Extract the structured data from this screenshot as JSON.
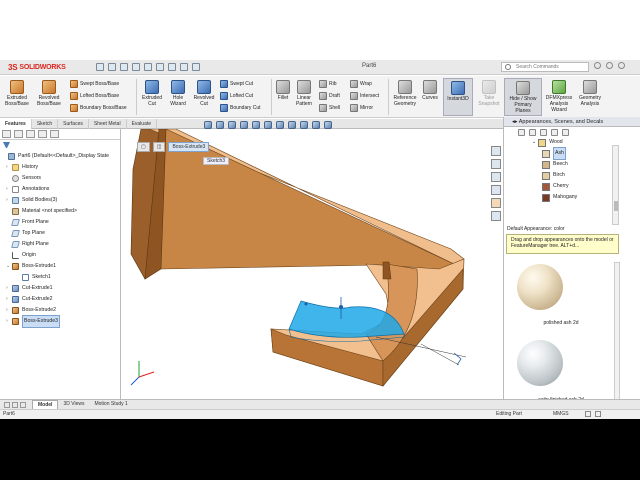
{
  "titlebar": {
    "logo_prefix": "3S",
    "logo_text": "SOLIDWORKS",
    "document_title": "Part6",
    "search_placeholder": "Search Commands"
  },
  "ribbon": {
    "extruded_boss": "Extruded\nBoss/Base",
    "revolved_boss": "Revolved\nBoss/Base",
    "swept_boss": "Swept Boss/Base",
    "lofted_boss": "Lofted Boss/Base",
    "boundary_boss": "Boundary Boss/Base",
    "extruded_cut": "Extruded\nCut",
    "hole_wizard": "Hole\nWizard",
    "revolved_cut": "Revolved\nCut",
    "swept_cut": "Swept Cut",
    "lofted_cut": "Lofted Cut",
    "boundary_cut": "Boundary Cut",
    "fillet": "Fillet",
    "linear_pattern": "Linear\nPattern",
    "rib": "Rib",
    "draft": "Draft",
    "shell": "Shell",
    "wrap": "Wrap",
    "intersect": "Intersect",
    "mirror": "Mirror",
    "reference_geometry": "Reference\nGeometry",
    "curves": "Curves",
    "instant3d": "Instant3D",
    "take_snapshot": "Take\nSnapshot",
    "hide_show_planes": "Hide / Show\nPrimary\nPlanes",
    "dfmxpress": "DFMXpress\nAnalysis\nWizard",
    "geometry_analysis": "Geometry\nAnalysis"
  },
  "command_tabs": [
    "Features",
    "Sketch",
    "Surfaces",
    "Sheet Metal",
    "Evaluate"
  ],
  "tree": {
    "root": "Part6  (Default<<Default>_Display State",
    "items": [
      {
        "label": "History",
        "icon": "folder"
      },
      {
        "label": "Sensors",
        "icon": "sensor"
      },
      {
        "label": "Annotations",
        "icon": "annotation"
      },
      {
        "label": "Solid Bodies(3)",
        "icon": "body"
      },
      {
        "label": "Material <not specified>",
        "icon": "material"
      },
      {
        "label": "Front Plane",
        "icon": "plane"
      },
      {
        "label": "Top Plane",
        "icon": "plane"
      },
      {
        "label": "Right Plane",
        "icon": "plane"
      },
      {
        "label": "Origin",
        "icon": "origin"
      },
      {
        "label": "Boss-Extrude1",
        "icon": "extrude"
      },
      {
        "label": "Sketch1",
        "icon": "sketch"
      },
      {
        "label": "Cut-Extrude1",
        "icon": "cut"
      },
      {
        "label": "Cut-Extrude2",
        "icon": "cut"
      },
      {
        "label": "Boss-Extrude2",
        "icon": "extrude"
      },
      {
        "label": "Boss-Extrude3",
        "icon": "extrude"
      }
    ]
  },
  "viewport": {
    "breadcrumb_feature": "Boss-Extrude3",
    "breadcrumb_sketch": "Sketch3"
  },
  "appearance_panel": {
    "title": "Appearances, Scenes, and Decals",
    "folder": "Wood",
    "materials": [
      "Ash",
      "Beech",
      "Birch",
      "Cherry",
      "Mahogany"
    ],
    "selected": "Ash",
    "default_label": "Default Appearance: color",
    "tip": "Drag and drop appearances onto the model or FeatureManager tree. ALT+d...",
    "thumb1": "polished ash 2d",
    "thumb2": "satin finished ash 2d",
    "swatch_colors": [
      "#e8d6b4",
      "#d6b48a",
      "#e3cfa5",
      "#a4583a",
      "#7a3a22"
    ]
  },
  "bottom_tabs": [
    "Model",
    "3D Views",
    "Motion Study 1"
  ],
  "status": {
    "left": "Part6",
    "editing": "Editing Part",
    "units": "MMGS"
  },
  "colors": {
    "part_face": "#f2bf8f",
    "part_side": "#a8692f",
    "selection": "#1fa8e8",
    "brand_red": "#d9261c"
  }
}
